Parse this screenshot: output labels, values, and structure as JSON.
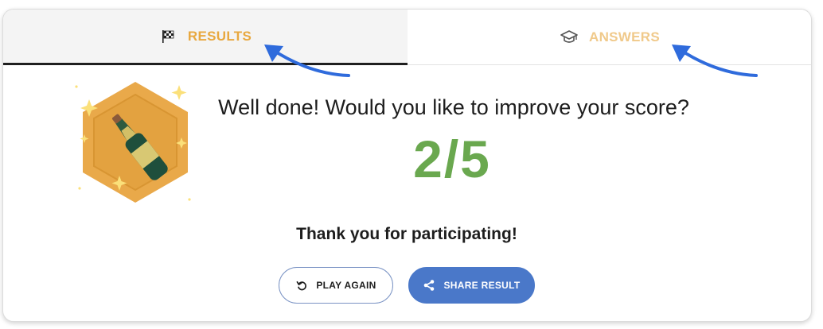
{
  "tabs": {
    "results": {
      "label": "RESULTS",
      "icon": "checkered-flag-icon",
      "active": true
    },
    "answers": {
      "label": "ANSWERS",
      "icon": "graduation-cap-icon",
      "active": false
    }
  },
  "result": {
    "headline": "Well done! Would you like to improve your score?",
    "score": "2/5",
    "thanks": "Thank you for participating!",
    "badge_icon": "champagne-bottle-icon"
  },
  "actions": {
    "play_again": {
      "label": "PLAY AGAIN",
      "icon": "replay-icon"
    },
    "share_result": {
      "label": "SHARE RESULT",
      "icon": "share-icon"
    }
  },
  "colors": {
    "accent_orange": "#e8a83f",
    "score_green": "#6aa84f",
    "button_blue": "#4a78c9",
    "annotation_arrow": "#2f6bdc"
  }
}
